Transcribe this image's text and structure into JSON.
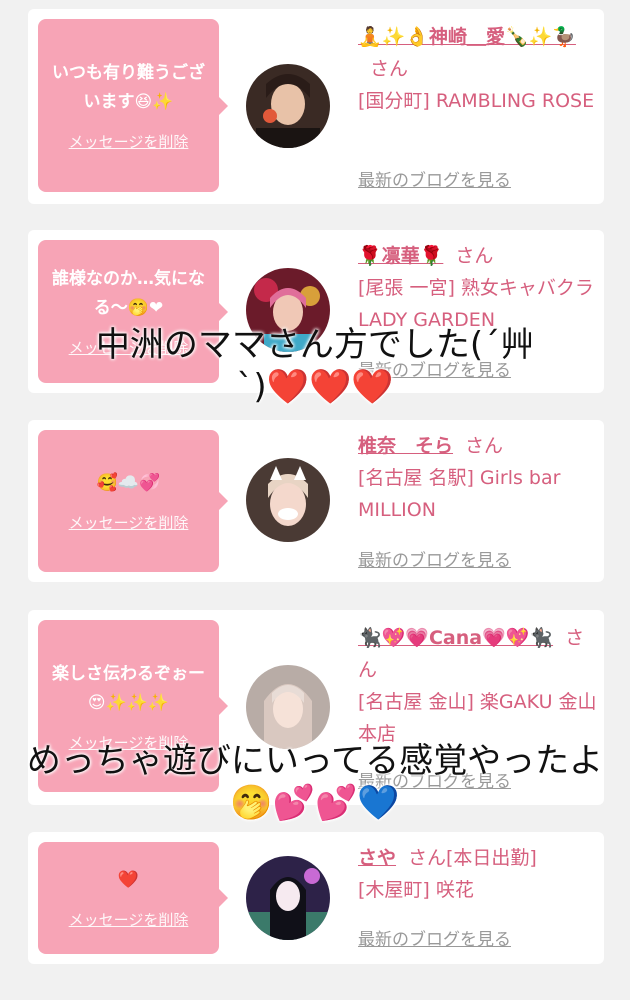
{
  "cards": [
    {
      "message": "いつも有り難うございます😆✨",
      "delete_label": "メッセージを削除",
      "name": "🧘✨👌神崎＿愛🍾✨🦆",
      "san": "さん",
      "shop": "[国分町] RAMBLING ROSE",
      "blog_label": "最新のブログを見る",
      "avatar_color": "#3a2a24"
    },
    {
      "message": "誰様なのか…気になる〜🤭❤",
      "delete_label": "メッセージを削除",
      "name": "🌹凛華🌹",
      "san": "さん",
      "shop": "[尾張 一宮] 熟女キャバクラ LADY GARDEN",
      "blog_label": "最新のブログを見る",
      "avatar_color": "#6b1b2a"
    },
    {
      "message": "🥰☁️💞",
      "delete_label": "メッセージを削除",
      "name": "椎奈　そら",
      "san": "さん",
      "shop": "[名古屋 名駅] Girls bar MILLION",
      "blog_label": "最新のブログを見る",
      "avatar_color": "#4a3a34"
    },
    {
      "message": "楽しさ伝わるぞぉー😍✨✨✨",
      "delete_label": "メッセージを削除",
      "name": "🐈‍⬛💖💗Cana💗💖🐈‍⬛",
      "san": "さん",
      "shop": "[名古屋 金山] 楽GAKU 金山本店",
      "blog_label": "最新のブログを見る",
      "avatar_color": "#b8aca6"
    },
    {
      "message": "❤️",
      "delete_label": "メッセージを削除",
      "name": "さや",
      "san": "さん[本日出勤]",
      "shop": "[木屋町] 咲花",
      "blog_label": "最新のブログを見る",
      "avatar_color": "#2d2248"
    }
  ],
  "captions": {
    "top_line1": "中洲のママさん方でした(´艸",
    "top_line2": "`)",
    "top_hearts": "❤️❤️❤️",
    "bottom_line1": "めっちゃ遊びにいってる感覚やったよ",
    "bottom_line2": "🤭💕💕💙"
  },
  "colors": {
    "background": "#f1f1f1",
    "bubble": "#f7a4b6",
    "name_pink": "#d65f7e",
    "link_gray": "#999999"
  }
}
